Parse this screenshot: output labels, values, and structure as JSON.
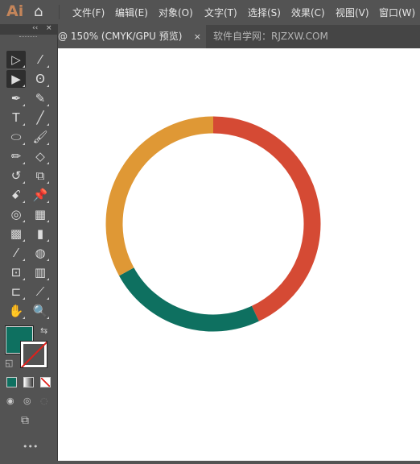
{
  "app": {
    "logo": "Ai",
    "home_icon": "home-icon"
  },
  "menu": [
    "文件(F)",
    "编辑(E)",
    "对象(O)",
    "文字(T)",
    "选择(S)",
    "效果(C)",
    "视图(V)",
    "窗口(W)"
  ],
  "tabs": [
    {
      "label": "@ 150% (CMYK/GPU 预览)",
      "close": "×",
      "active": true
    },
    {
      "label": "软件自学网：RJZXW.COM",
      "active": false
    }
  ],
  "toolbar": {
    "collapse": "‹‹",
    "close": "×",
    "more": "•••",
    "tools": [
      [
        "selection-tool",
        "▷"
      ],
      [
        "magic-wand-tool",
        "⁄"
      ],
      [
        "direct-selection-tool",
        "▶"
      ],
      [
        "lasso-tool",
        "ʘ"
      ],
      [
        "pen-tool",
        "✒"
      ],
      [
        "curvature-tool",
        "✎"
      ],
      [
        "type-tool",
        "T"
      ],
      [
        "line-tool",
        "╱"
      ],
      [
        "ellipse-tool",
        "⬭"
      ],
      [
        "paintbrush-tool",
        "🖌"
      ],
      [
        "pencil-tool",
        "✏"
      ],
      [
        "eraser-tool",
        "◇"
      ],
      [
        "rotate-tool",
        "↺"
      ],
      [
        "scale-tool",
        "⧉"
      ],
      [
        "warp-tool",
        "ꗃ"
      ],
      [
        "puppet-warp-tool",
        "📌"
      ],
      [
        "shape-builder-tool",
        "◎"
      ],
      [
        "perspective-grid-tool",
        "▦"
      ],
      [
        "mesh-tool",
        "▩"
      ],
      [
        "gradient-tool",
        "▮"
      ],
      [
        "eyedropper-tool",
        "⁄"
      ],
      [
        "blend-tool",
        "◍"
      ],
      [
        "symbol-sprayer-tool",
        "⊡"
      ],
      [
        "column-graph-tool",
        "▥"
      ],
      [
        "artboard-tool",
        "⊏"
      ],
      [
        "slice-tool",
        "⟋"
      ],
      [
        "hand-tool",
        "✋"
      ],
      [
        "zoom-tool",
        "🔍"
      ]
    ]
  },
  "colors": {
    "fill": "#0e7060",
    "stroke": "none"
  },
  "ring": {
    "segments": [
      {
        "color": "#d54a34",
        "percent": 43
      },
      {
        "color": "#0e7060",
        "percent": 24
      },
      {
        "color": "#df9835",
        "percent": 33
      }
    ]
  }
}
